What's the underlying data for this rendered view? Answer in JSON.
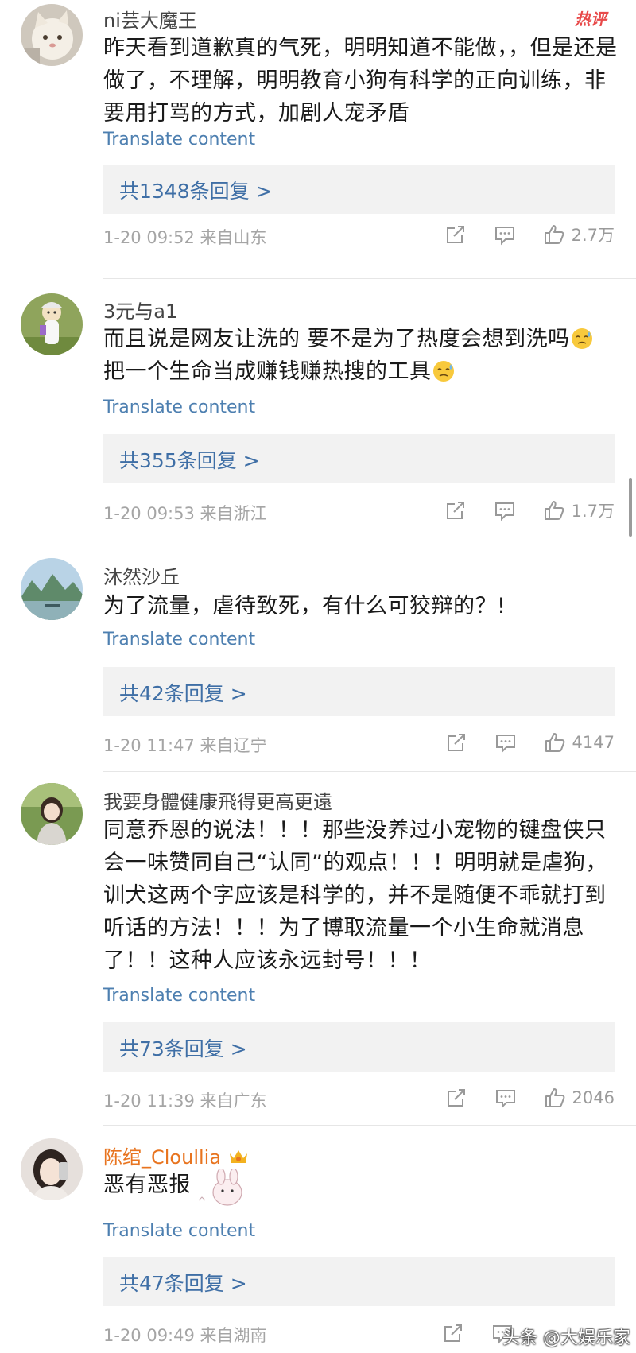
{
  "hot_badge": "热评",
  "comments": [
    {
      "username": "ni芸大魔王",
      "content": "昨天看到道歉真的气死，明明知道不能做，，但是还是做了，不理解，明明教育小狗有科学的正向训练，非要用打骂的方式，加剧人宠矛盾",
      "translate": "Translate content",
      "replies": "共1348条回复 >",
      "meta": "1-20 09:52  来自山东",
      "likes": "2.7万",
      "avatar_icon": "cat-avatar-icon"
    },
    {
      "username": "3元与a1",
      "content_line1": "而且说是网友让洗的 要不是为了热度会想到洗吗",
      "content_line2": "把一个生命当成赚钱赚热搜的工具",
      "emoji_icon": "sweat-face-emoji-icon",
      "translate": "Translate content",
      "replies": "共355条回复 >",
      "meta": "1-20 09:53  来自浙江",
      "likes": "1.7万",
      "avatar_icon": "cartoon-avatar-icon"
    },
    {
      "username": "沐然沙丘",
      "content": "为了流量，虐待致死，有什么可狡辩的？!",
      "translate": "Translate content",
      "replies": "共42条回复 >",
      "meta": "1-20 11:47  来自辽宁",
      "likes": "4147",
      "avatar_icon": "landscape-avatar-icon"
    },
    {
      "username": "我要身體健康飛得更高更遠",
      "content": "同意乔恩的说法！！！那些没养过小宠物的键盘侠只会一味赞同自己“认同”的观点！！！明明就是虐狗，训犬这两个字应该是科学的，并不是随便不乖就打到听话的方法！！！为了博取流量一个小生命就消息了！！这种人应该永远封号！！！",
      "translate": "Translate content",
      "replies": "共73条回复 >",
      "meta": "1-20 11:39  来自广东",
      "likes": "2046",
      "avatar_icon": "girl-avatar-icon"
    },
    {
      "username": "陈绾_Cloullia",
      "content": "恶有恶报",
      "translate": "Translate content",
      "replies": "共47条回复 >",
      "meta": "1-20 09:49  来自湖南",
      "avatar_icon": "selfie-avatar-icon",
      "badge_icon": "crown-vip-icon"
    }
  ],
  "watermark": "头条 @大娱乐家",
  "colors": {
    "link": "#4d7fb0",
    "reply_text": "#3f6fa6",
    "reply_bg": "#f2f2f2",
    "meta": "#a5a5a5",
    "vip_name": "#e8741f",
    "hot": "#e84a4a"
  }
}
